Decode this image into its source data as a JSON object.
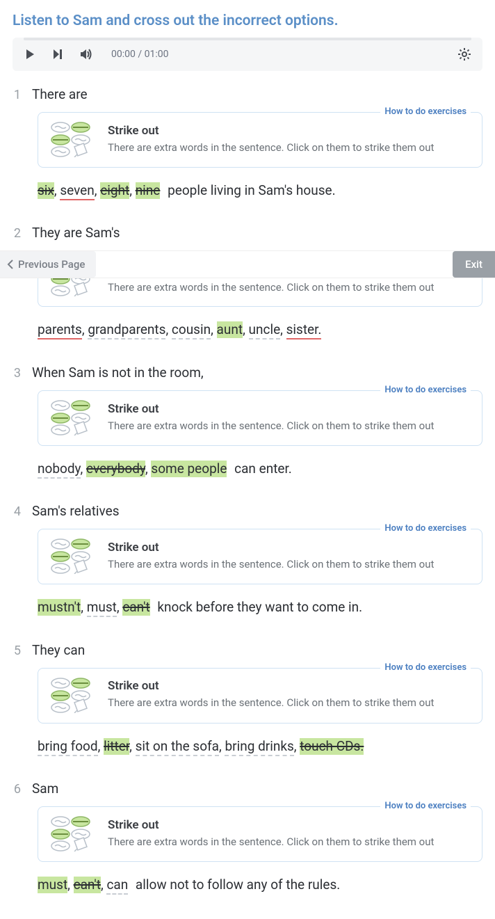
{
  "title": "Listen to Sam and cross out the incorrect options.",
  "audio": {
    "time": "00:00 / 01:00"
  },
  "nav": {
    "prev": "Previous Page",
    "exit": "Exit"
  },
  "hint": {
    "link": "How to do exercises",
    "title": "Strike out",
    "desc": "There are extra words in the sentence. Click on them to strike them out"
  },
  "questions": [
    {
      "num": "1",
      "prefix": "There are",
      "options": [
        {
          "text": "six",
          "state": "struck"
        },
        {
          "text": "seven",
          "state": "wrong-nostrike"
        },
        {
          "text": "eight",
          "state": "struck"
        },
        {
          "text": "nine",
          "state": "struck"
        }
      ],
      "suffix": " people living in Sam's house.",
      "clipped": false
    },
    {
      "num": "2",
      "prefix": "They are Sam's",
      "options": [
        {
          "text": "parents",
          "state": "wrong-nostrike"
        },
        {
          "text": "grandparents",
          "state": "normal"
        },
        {
          "text": "cousin",
          "state": "normal"
        },
        {
          "text": "aunt",
          "state": "correct"
        },
        {
          "text": "uncle",
          "state": "normal"
        },
        {
          "text": "sister.",
          "state": "wrong-nostrike"
        }
      ],
      "suffix": "",
      "clipped": true
    },
    {
      "num": "3",
      "prefix": "When Sam is not in the room,",
      "options": [
        {
          "text": "nobody",
          "state": "normal"
        },
        {
          "text": "everybody",
          "state": "struck"
        },
        {
          "text": "some people",
          "state": "correct"
        }
      ],
      "suffix": " can enter.",
      "clipped": false
    },
    {
      "num": "4",
      "prefix": "Sam's relatives",
      "options": [
        {
          "text": "mustn't",
          "state": "correct"
        },
        {
          "text": "must",
          "state": "normal"
        },
        {
          "text": "can't",
          "state": "struck"
        }
      ],
      "suffix": " knock before they want to come in.",
      "clipped": false
    },
    {
      "num": "5",
      "prefix": "They can",
      "options": [
        {
          "text": "bring food",
          "state": "normal"
        },
        {
          "text": "litter",
          "state": "struck"
        },
        {
          "text": "sit on the sofa",
          "state": "normal"
        },
        {
          "text": "bring drinks",
          "state": "normal"
        },
        {
          "text": "touch CDs.",
          "state": "struck"
        }
      ],
      "suffix": "",
      "clipped": false
    },
    {
      "num": "6",
      "prefix": "Sam",
      "options": [
        {
          "text": "must",
          "state": "correct"
        },
        {
          "text": "can't",
          "state": "struck"
        },
        {
          "text": "can",
          "state": "normal"
        }
      ],
      "suffix": " allow not to follow any of the rules.",
      "clipped": false
    }
  ]
}
